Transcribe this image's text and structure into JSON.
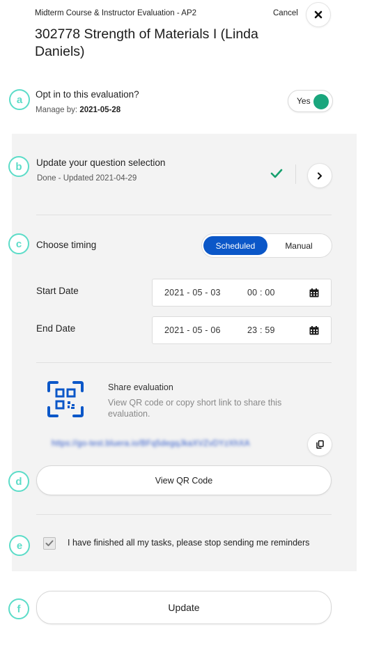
{
  "header": {
    "subtitle": "Midterm Course & Instructor Evaluation - AP2",
    "cancel_label": "Cancel",
    "title": "302778 Strength of Materials I (Linda Daniels)"
  },
  "markers": [
    "a",
    "b",
    "c",
    "d",
    "e",
    "f"
  ],
  "opt_in": {
    "label": "Opt in to this evaluation?",
    "manage_by_label": "Manage by:",
    "manage_by_date": "2021-05-28",
    "toggle_label": "Yes",
    "toggle_on": true
  },
  "questions": {
    "title": "Update your question selection",
    "status": "Done - Updated 2021-04-29"
  },
  "timing": {
    "label": "Choose timing",
    "options": [
      "Scheduled",
      "Manual"
    ],
    "selected": "Scheduled",
    "start_label": "Start Date",
    "start_date": "2021 - 05 - 03",
    "start_time": "00 : 00",
    "end_label": "End Date",
    "end_date": "2021 - 05 - 06",
    "end_time": "23 : 59"
  },
  "share": {
    "title": "Share evaluation",
    "description": "View QR code or copy short link to share this evaluation.",
    "short_link": "https://go-test.bluera.io/BFq5degqJkaXVZvDYzXhXA",
    "qr_button_label": "View QR Code"
  },
  "reminders": {
    "label": "I have finished all my tasks, please stop sending me reminders",
    "checked": true
  },
  "update_label": "Update",
  "colors": {
    "accent_blue": "#0b57c8",
    "toggle_green": "#1aa67d",
    "check_green": "#16a06e",
    "marker_teal": "#5cdcc8",
    "panel_gray": "#f3f3f3"
  }
}
